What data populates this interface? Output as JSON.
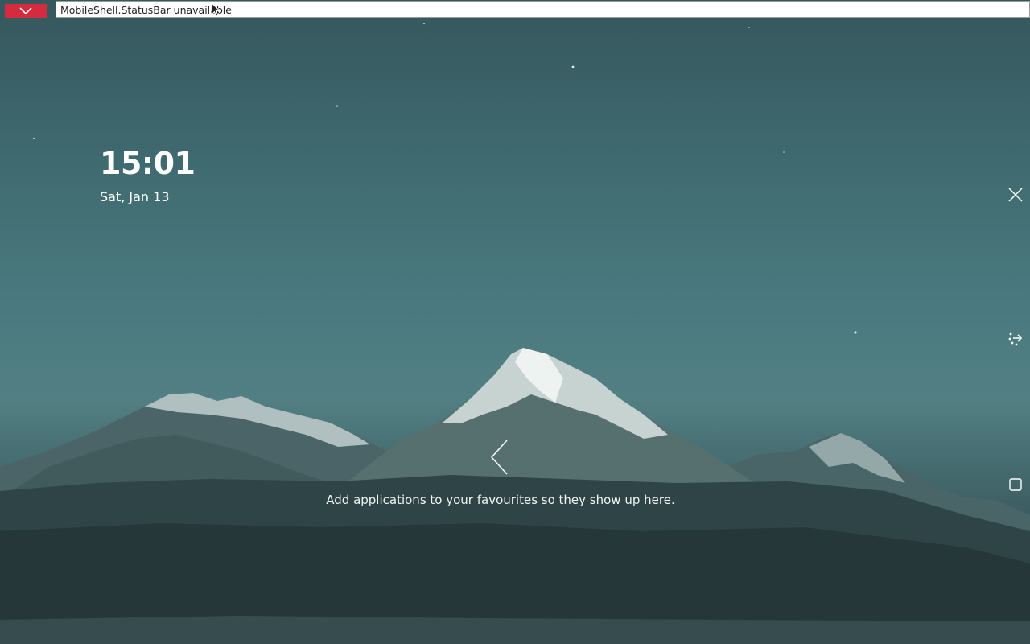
{
  "status_bar": {
    "message": "MobileShell.StatusBar unavailable",
    "close_icon": "chevron-down-icon"
  },
  "lockscreen": {
    "time": "15:01",
    "date": "Sat, Jan 13"
  },
  "homescreen": {
    "favourites_hint": "Add applications to your favourites so they show up here.",
    "drawer_icon": "chevron-left-icon"
  },
  "side_panel": {
    "close_icon": "close-icon",
    "rotate_icon": "rotate-icon",
    "overview_icon": "square-icon"
  },
  "colors": {
    "accent_red": "#d52b3f",
    "sky_top": "#35575d",
    "sky_mid": "#4a7a7f",
    "ground": "#243638"
  }
}
